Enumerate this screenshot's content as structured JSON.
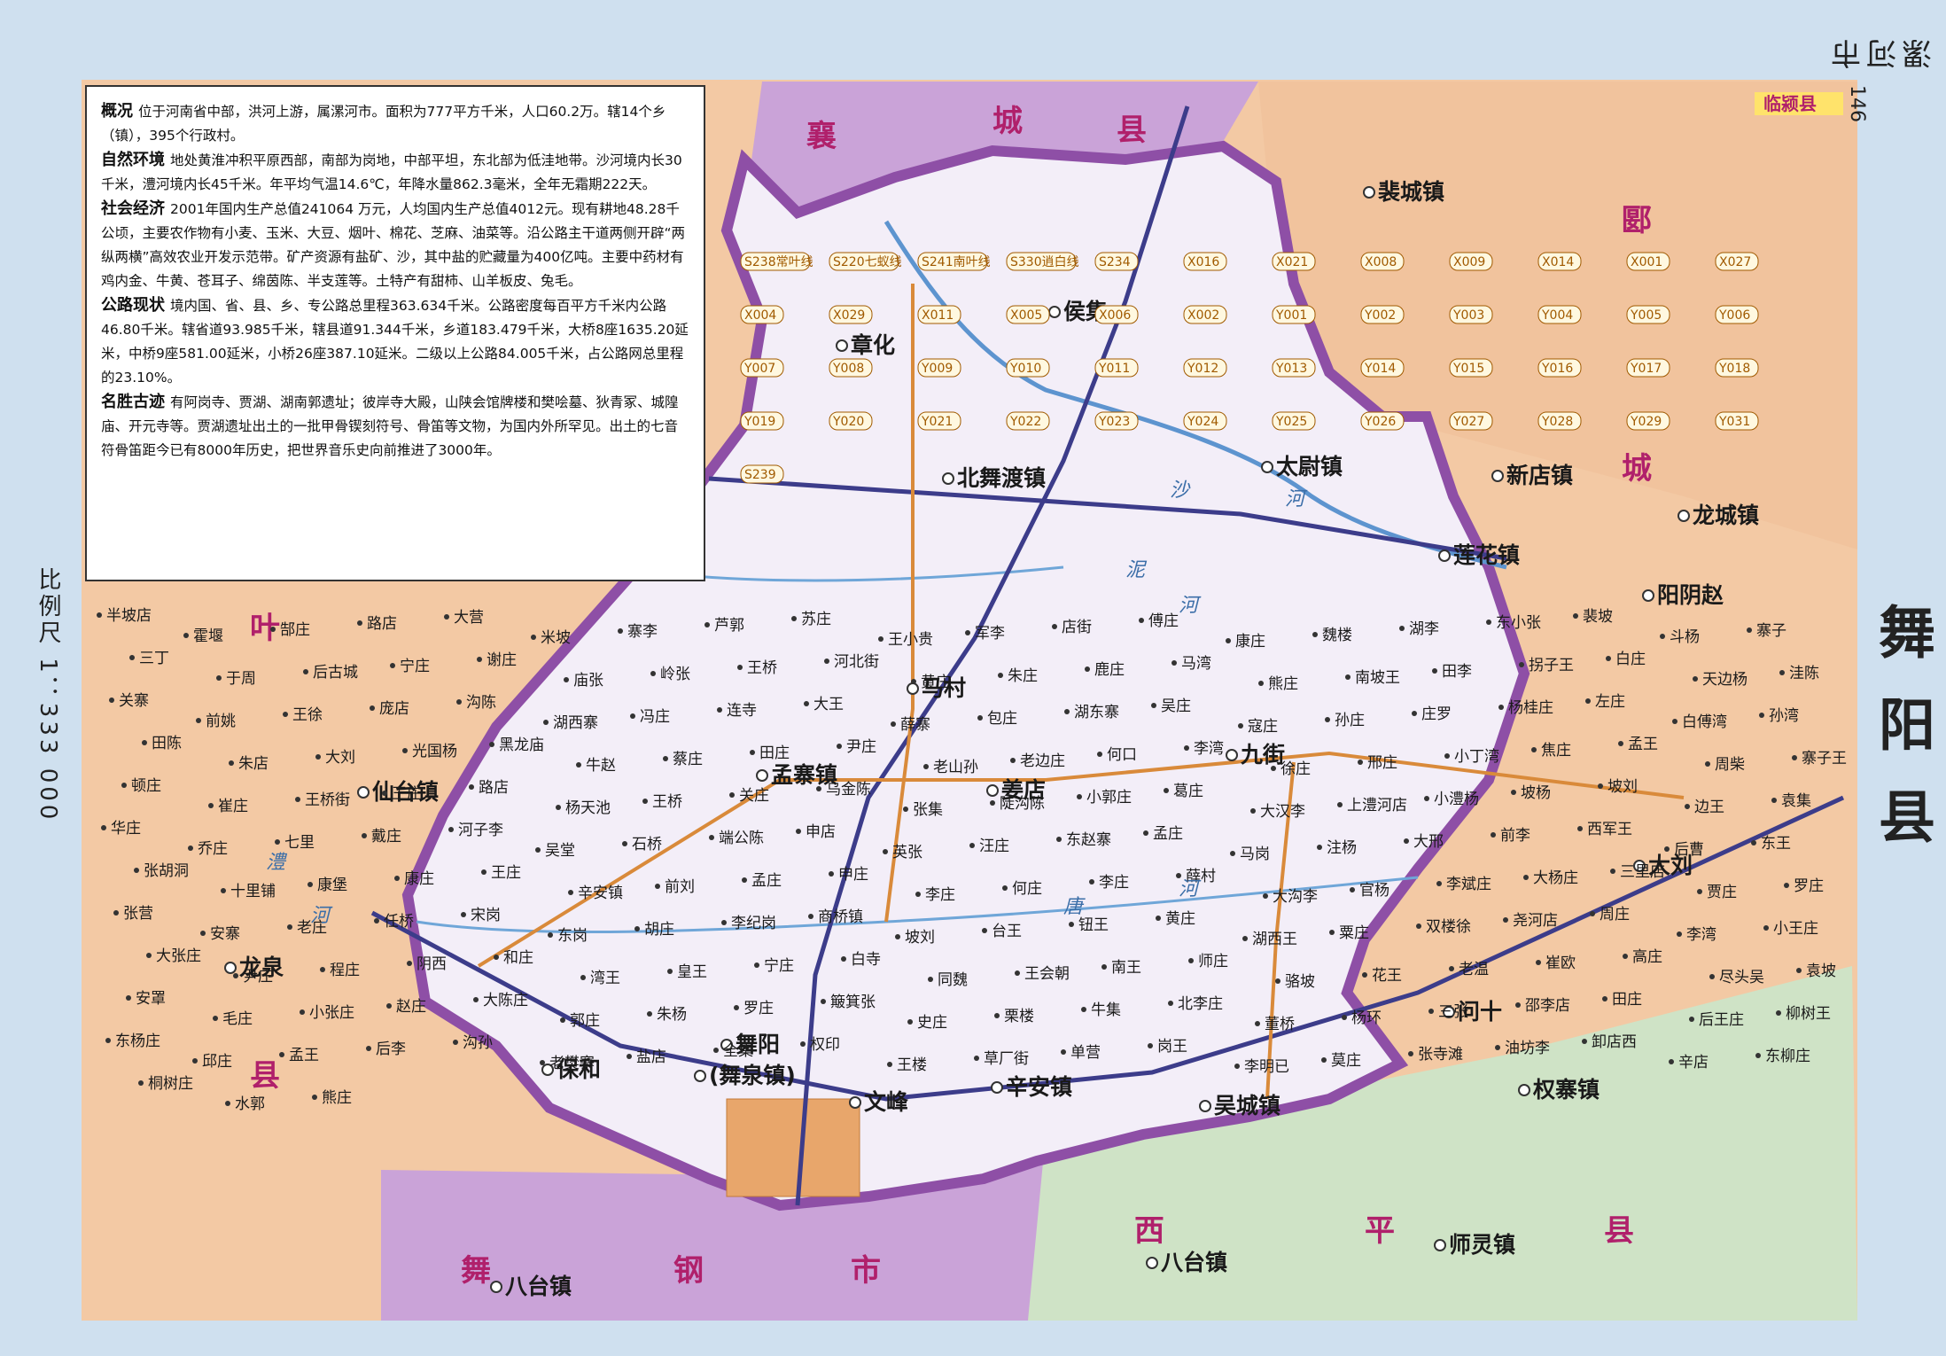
{
  "header": {
    "text": "漯河市",
    "page_number": "146"
  },
  "title": "舞阳县",
  "scale": "比例尺   1：333 000",
  "info_box": {
    "sections": [
      {
        "heading": "概况",
        "text": "位于河南省中部，洪河上游，属漯河市。面积为777平方千米，人口60.2万。辖14个乡（镇），395个行政村。"
      },
      {
        "heading": "自然环境",
        "text": "地处黄淮冲积平原西部，南部为岗地，中部平坦，东北部为低洼地带。沙河境内长30千米，澧河境内长45千米。年平均气温14.6℃，年降水量862.3毫米，全年无霜期222天。"
      },
      {
        "heading": "社会经济",
        "text": "2001年国内生产总值241064 万元，人均国内生产总值4012元。现有耕地48.28千公顷，主要农作物有小麦、玉米、大豆、烟叶、棉花、芝麻、油菜等。沿公路主干道两侧开辟“两纵两横”高效农业开发示范带。矿产资源有盐矿、沙，其中盐的贮藏量为400亿吨。主要中药材有鸡内金、牛黄、苍耳子、绵茵陈、半支莲等。土特产有甜柿、山羊板皮、兔毛。"
      },
      {
        "heading": "公路现状",
        "text": "境内国、省、县、乡、专公路总里程363.634千米。公路密度每百平方千米内公路46.80千米。辖省道93.985千米，辖县道91.344千米，乡道183.479千米，大桥8座1635.20延米，中桥9座581.00延米，小桥26座387.10延米。二级以上公路84.005千米，占公路网总里程的23.10%。"
      },
      {
        "heading": "名胜古迹",
        "text": "有阿岗寺、贾湖、湖南郭遗址；彼岸寺大殿，山陕会馆牌楼和樊哙墓、狄青冢、城隍庙、开元寺等。贾湖遗址出土的一批甲骨锲刻符号、骨笛等文物，为国内外所罕见。出土的七音符骨笛距今已有8000年历史，把世界音乐史向前推进了3000年。"
      }
    ]
  },
  "colors": {
    "county_fill": "#f3eef8",
    "border": "#8e4fa6",
    "neighbor_orange": "#f3c9a4",
    "neighbor_purple": "#caa3d8",
    "neighbor_green": "#cfe3c6",
    "river": "#5d94cf",
    "road_provincial": "#3c3c8a",
    "road_county": "#d98a3a"
  },
  "neighbors": [
    {
      "name": "襄城县",
      "chars": [
        "襄",
        "城",
        "县"
      ]
    },
    {
      "name": "郾城县",
      "chars": [
        "郾",
        "城"
      ]
    },
    {
      "name": "叶县",
      "chars": [
        "叶",
        "县"
      ]
    },
    {
      "name": "舞钢市",
      "chars": [
        "舞",
        "钢",
        "市"
      ]
    },
    {
      "name": "西平县",
      "chars": [
        "西",
        "平",
        "县"
      ]
    },
    {
      "name": "临颍县",
      "chars": [
        "临颍县"
      ]
    }
  ],
  "towns": [
    "章化",
    "侯集",
    "北舞渡镇",
    "太尉镇",
    "莲花镇",
    "马村",
    "孟寨镇",
    "姜店",
    "九街",
    "舞阳",
    "(舞泉镇)",
    "文峰",
    "辛安镇",
    "吴城镇",
    "保和",
    "裴城镇",
    "新店镇",
    "龙城镇",
    "阳阴赵",
    "仙台镇",
    "龙泉",
    "问十",
    "权寨镇",
    "师灵镇",
    "八台镇",
    "八台镇 ",
    "大刘"
  ],
  "villages": [
    "半坡店",
    "霍堰",
    "郜庄",
    "路店",
    "大营",
    "米坡",
    "寨李",
    "芦郭",
    "苏庄",
    "王小贵",
    "军李",
    "店街",
    "傅庄",
    "康庄",
    "魏楼",
    "湖李",
    "东小张",
    "裴坡",
    "斗杨",
    "寨子",
    "三丁",
    "于周",
    "后古城",
    "宁庄",
    "谢庄",
    "庙张",
    "岭张",
    "王桥",
    "河北街",
    "黄庄",
    "朱庄",
    "鹿庄",
    "马湾",
    "熊庄",
    "南坡王",
    "田李",
    "拐子王",
    "白庄",
    "天边杨",
    "洼陈",
    "关寨",
    "前姚",
    "王徐",
    "庞店",
    "沟陈",
    "湖西寨",
    "冯庄",
    "连寺",
    "大王",
    "薛寨",
    "包庄",
    "湖东寨",
    "吴庄",
    "寇庄",
    "孙庄",
    "庄罗",
    "杨桂庄",
    "左庄",
    "白傅湾",
    "孙湾",
    "田陈",
    "朱店",
    "大刘 ",
    "光国杨",
    "黑龙庙",
    "牛赵",
    "蔡庄",
    "田庄",
    "尹庄",
    "老山孙",
    "老边庄",
    "何口",
    "李湾",
    "徐庄",
    "邢庄",
    "小丁湾",
    "焦庄",
    "孟王",
    "周柴",
    "寨子王",
    "顿庄",
    "崔庄",
    "王桥街",
    "王庄",
    "路店 ",
    "杨天池",
    "王桥 ",
    "关庄",
    "乌金陈",
    "张集",
    "陡沟陈",
    "小郭庄",
    "葛庄",
    "大汉李",
    "上澧河店",
    "小澧杨",
    "坡杨",
    "坡刘",
    "边王",
    "袁集",
    "华庄",
    "乔庄",
    "七里",
    "戴庄",
    "河子李",
    "吴堂",
    "石桥",
    "端公陈",
    "申店",
    "英张",
    "汪庄",
    "东赵寨",
    "孟庄",
    "马岗",
    "注杨",
    "大邢",
    "前李",
    "西军王",
    "后曹",
    "东王",
    "张胡洞",
    "十里铺",
    "康堡",
    "康庄 ",
    "王庄 ",
    "辛安镇",
    "前刘",
    "孟庄 ",
    "申庄",
    "李庄",
    "何庄",
    "李庄 ",
    "薛村",
    "大沟李",
    "官杨",
    "李斌庄",
    "大杨庄",
    "三里店",
    "贾庄",
    "罗庄",
    "张营",
    "安寨",
    "老庄",
    "任桥",
    "宋岗",
    "东岗",
    "胡庄",
    "李纪岗",
    "商桥镇",
    "坡刘 ",
    "台王",
    "钮王",
    "黄庄 ",
    "湖西王",
    "粟庄",
    "双楼徐",
    "尧河店",
    "周庄",
    "李湾 ",
    "小王庄",
    "大张庄",
    "尹庄 ",
    "程庄",
    "阴西",
    "和庄",
    "湾王",
    "皇王",
    "宁庄 ",
    "白寺",
    "同魏",
    "王会朝",
    "南王",
    "师庄",
    "骆坡",
    "花王",
    "老温",
    "崔欧",
    "高庄",
    "尽头吴",
    "袁坡",
    "安罩",
    "毛庄",
    "小张庄",
    "赵庄",
    "大陈庄",
    "郭庄",
    "朱杨",
    "罗庄 ",
    "簸箕张",
    "史庄",
    "栗楼",
    "牛集",
    "北李庄",
    "董桥",
    "杨环",
    "三张",
    "邵李店",
    "田庄 ",
    "后王庄",
    "柳树王",
    "东杨庄",
    "邱庄",
    "孟王 ",
    "后李",
    "沟孙",
    "老樊寨",
    "盐店",
    "全集",
    "权印",
    "王楼",
    "草厂街",
    "单营",
    "岗王",
    "李明已",
    "莫庄",
    "张寺滩",
    "油坊李",
    "卸店西",
    "辛店",
    "东柳庄",
    "桐树庄",
    "水郭",
    "熊庄 "
  ],
  "roads": [
    "S238常叶线",
    "S220七蚁线",
    "S241南叶线",
    "S330逍白线",
    "S234",
    "X016",
    "X021",
    "X008",
    "X009",
    "X014",
    "X001",
    "X027",
    "X004",
    "X029",
    "X011",
    "X005",
    "X006",
    "X002",
    "Y001",
    "Y002",
    "Y003",
    "Y004",
    "Y005",
    "Y006",
    "Y007",
    "Y008",
    "Y009",
    "Y010",
    "Y011",
    "Y012",
    "Y013",
    "Y014",
    "Y015",
    "Y016",
    "Y017",
    "Y018",
    "Y019",
    "Y020",
    "Y021",
    "Y022",
    "Y023",
    "Y024",
    "Y025",
    "Y026",
    "Y027",
    "Y028",
    "Y029",
    "Y031",
    "S239"
  ],
  "rivers": [
    "沙",
    "河",
    "泥",
    "河",
    "澧",
    "河",
    "唐",
    "河"
  ]
}
